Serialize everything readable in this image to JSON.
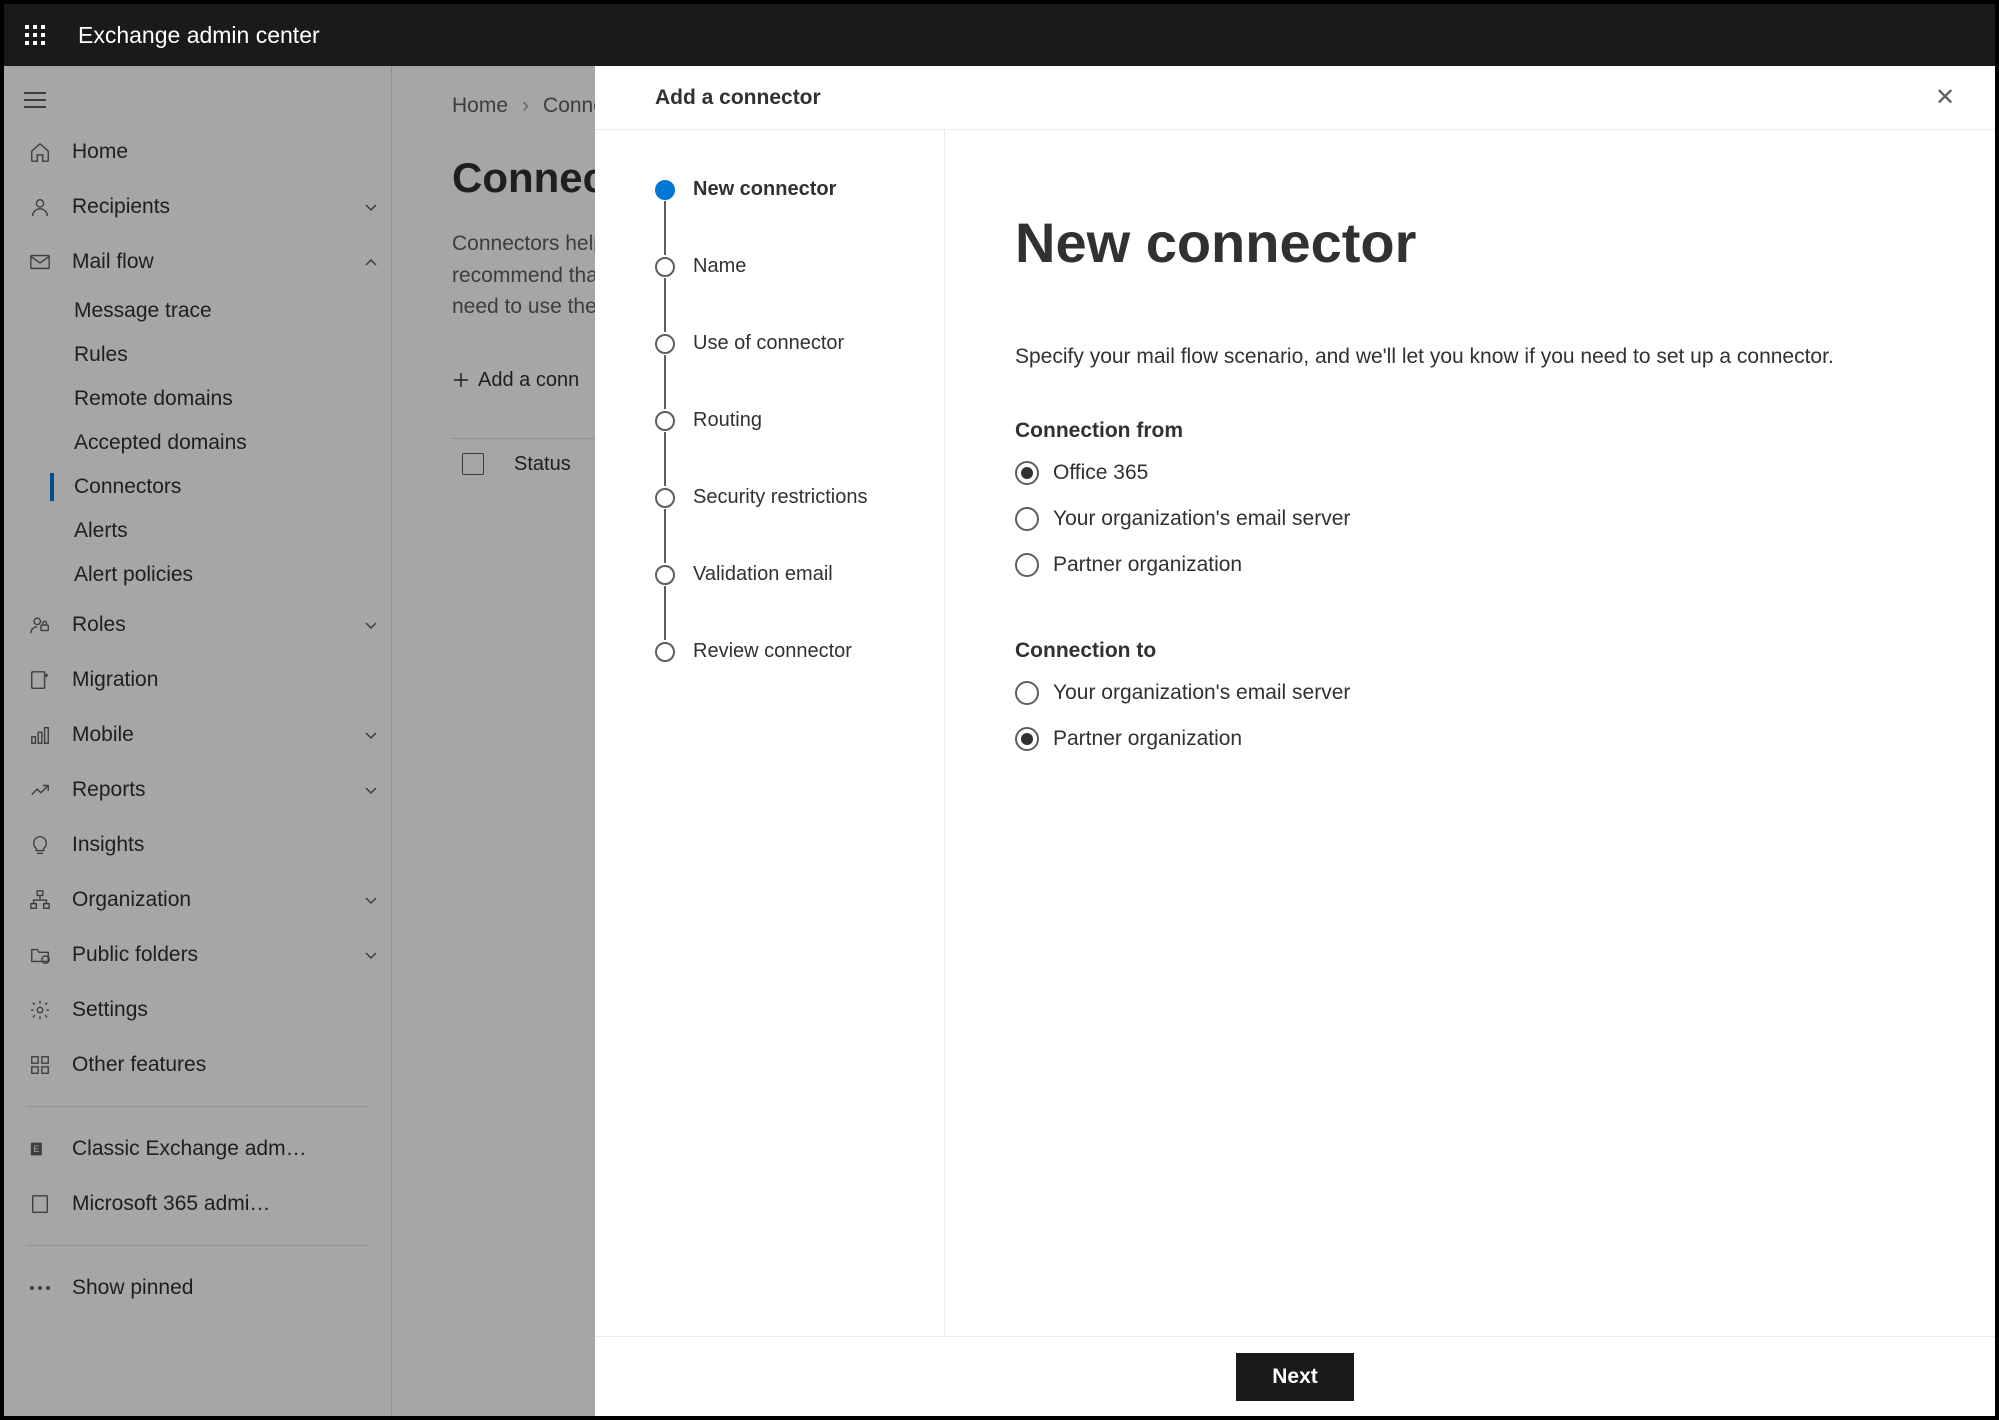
{
  "topbar": {
    "title": "Exchange admin center"
  },
  "nav": {
    "items": [
      {
        "icon": "home",
        "label": "Home"
      },
      {
        "icon": "person",
        "label": "Recipients",
        "chevron": "down"
      },
      {
        "icon": "mail",
        "label": "Mail flow",
        "chevron": "up",
        "expanded": true,
        "sub": [
          {
            "label": "Message trace"
          },
          {
            "label": "Rules"
          },
          {
            "label": "Remote domains"
          },
          {
            "label": "Accepted domains"
          },
          {
            "label": "Connectors",
            "active": true
          },
          {
            "label": "Alerts"
          },
          {
            "label": "Alert policies"
          }
        ]
      },
      {
        "icon": "roles",
        "label": "Roles",
        "chevron": "down"
      },
      {
        "icon": "migration",
        "label": "Migration"
      },
      {
        "icon": "mobile",
        "label": "Mobile",
        "chevron": "down"
      },
      {
        "icon": "reports",
        "label": "Reports",
        "chevron": "down"
      },
      {
        "icon": "insights",
        "label": "Insights"
      },
      {
        "icon": "org",
        "label": "Organization",
        "chevron": "down"
      },
      {
        "icon": "folders",
        "label": "Public folders",
        "chevron": "down"
      },
      {
        "icon": "settings",
        "label": "Settings"
      },
      {
        "icon": "other",
        "label": "Other features"
      }
    ],
    "links": [
      {
        "icon": "classic",
        "label": "Classic Exchange adm…"
      },
      {
        "icon": "m365",
        "label": "Microsoft 365 admi…"
      }
    ],
    "pinned": {
      "label": "Show pinned"
    }
  },
  "breadcrumbs": {
    "home": "Home",
    "current": "Conne"
  },
  "main": {
    "title": "Connect",
    "desc_line1": "Connectors help",
    "desc_line2": "recommend that",
    "desc_line3": "need to use ther",
    "add_btn": "Add a conn",
    "col_status": "Status"
  },
  "dialog": {
    "title": "Add a connector",
    "steps": [
      "New connector",
      "Name",
      "Use of connector",
      "Routing",
      "Security restrictions",
      "Validation email",
      "Review connector"
    ],
    "form": {
      "heading": "New connector",
      "intro": "Specify your mail flow scenario, and we'll let you know if you need to set up a connector.",
      "from_label": "Connection from",
      "from_options": [
        {
          "label": "Office 365",
          "checked": true
        },
        {
          "label": "Your organization's email server",
          "checked": false
        },
        {
          "label": "Partner organization",
          "checked": false
        }
      ],
      "to_label": "Connection to",
      "to_options": [
        {
          "label": "Your organization's email server",
          "checked": false
        },
        {
          "label": "Partner organization",
          "checked": true
        }
      ]
    },
    "next": "Next"
  }
}
